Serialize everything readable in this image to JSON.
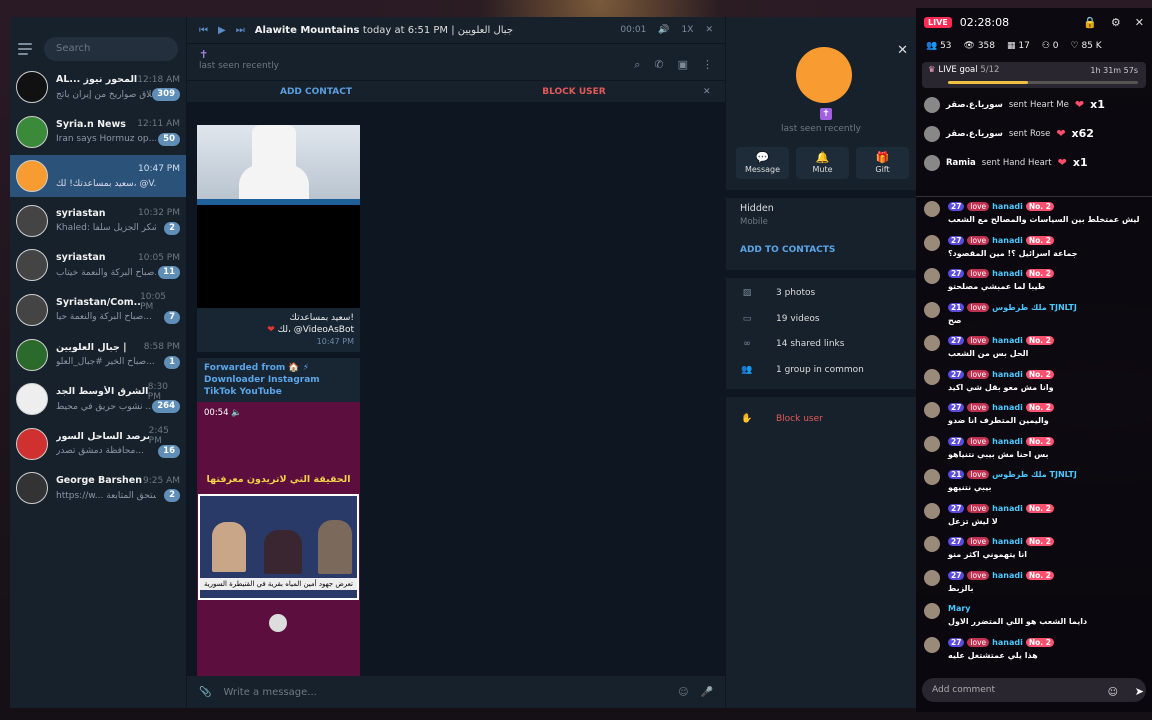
{
  "sidebar": {
    "search_placeholder": "Search",
    "chats": [
      {
        "name": "AL... المحور نيوز",
        "time": "12:18 AM",
        "preview": "إطلاق صواريخ من إيران باتج...",
        "badge": "309",
        "avatar_color": "#111111"
      },
      {
        "name": "Syria.n News",
        "time": "12:11 AM",
        "preview": "Iran says Hormuz op...",
        "badge": "50",
        "avatar_color": "#3a8a3a"
      },
      {
        "name": "",
        "time": "10:47 PM",
        "preview": "سعيد بمساعدتك! لك، @V...",
        "badge": "",
        "avatar_color": "#f89b30",
        "selected": true
      },
      {
        "name": "syriastan",
        "time": "10:32 PM",
        "preview": "Khaled: الشكر الجزيل سلفاً",
        "badge": "2",
        "avatar_color": "#444444"
      },
      {
        "name": "syriastan",
        "time": "10:05 PM",
        "preview": "صباح البركة والنعمة خيتاب...",
        "badge": "11",
        "avatar_color": "#444444"
      },
      {
        "name": "Syriastan/Com...",
        "time": "10:05 PM",
        "preview": "صباح البركة والنعمة حيا...",
        "badge": "7",
        "avatar_color": "#444444"
      },
      {
        "name": "جبال العلويين |",
        "time": "8:58 PM",
        "preview": "صباح الخير #جبال_العلو...",
        "badge": "1",
        "avatar_color": "#2a6a2a"
      },
      {
        "name": "الشرق الأوسط الجد...",
        "time": "8:30 PM",
        "preview": "نشوب حريق في محيط ...",
        "badge": "264",
        "avatar_color": "#eeeeee"
      },
      {
        "name": "مرصد الساحل السور...",
        "time": "2:45 PM",
        "preview": "محافظة دمشق تصدر...",
        "badge": "16",
        "avatar_color": "#d03030"
      },
      {
        "name": "George Barshen",
        "time": "9:25 AM",
        "preview": "https://w... تستحق المتابعة",
        "badge": "2",
        "avatar_color": "#333333"
      }
    ]
  },
  "player": {
    "title": "Alawite Mountains",
    "subtitle": "today at 6:51 PM | جبال العلويين",
    "elapsed": "00:01",
    "speed": "1X"
  },
  "chat_header": {
    "status": "last seen recently",
    "add_contact": "ADD CONTACT",
    "block_user": "BLOCK USER"
  },
  "messages": {
    "caption_line1": "سعيد بمساعدتك!",
    "caption_line2": "لك، @VideoAsBot",
    "caption_time": "10:47 PM",
    "forwarded": "Forwarded from 🏠 ⚡ Downloader Instagram TikTok YouTube",
    "video_time": "00:54",
    "video_title": "الحقيقة التي لاتريدون معرفتها",
    "video_strip": "تعرض جهود أمين المياه بقرية في القنيطرة السورية"
  },
  "compose": {
    "placeholder": "Write a message..."
  },
  "profile": {
    "status": "last seen recently",
    "btn_message": "Message",
    "btn_mute": "Mute",
    "btn_gift": "Gift",
    "phone_label": "Hidden",
    "phone_sub": "Mobile",
    "add_to_contacts": "ADD TO CONTACTS",
    "photos": "3 photos",
    "videos": "19 videos",
    "links": "14 shared links",
    "groups": "1 group in common",
    "block": "Block user"
  },
  "live": {
    "badge": "LIVE",
    "timer": "02:28:08",
    "stats": [
      "53",
      "358",
      "17",
      "0",
      "85 K"
    ],
    "goal_label": "LIVE goal",
    "goal_count": "5/12",
    "goal_time": "1h 31m 57s",
    "goal_fraction": 0.42,
    "gifts": [
      {
        "user": "سوريا.ع.صقر",
        "action": "sent Heart Me",
        "count": "x1"
      },
      {
        "user": "سوريا.ع.صقر",
        "action": "sent Rose",
        "count": "x62"
      },
      {
        "user": "Ramia",
        "action": "sent Hand Heart",
        "count": "x1"
      }
    ],
    "comments": [
      {
        "lvl": "27",
        "label": "love",
        "user": "hanadi",
        "rank": "No. 2",
        "text": "ليش عمتخلط بين السياسات والمصالح مع الشعب"
      },
      {
        "lvl": "27",
        "label": "love",
        "user": "hanadi",
        "rank": "No. 2",
        "text": "جماعة اسرائيل ؟! مين المقصود؟"
      },
      {
        "lvl": "27",
        "label": "love",
        "user": "hanadi",
        "rank": "No. 2",
        "text": "طيبا لما عمبشي مصلحتو"
      },
      {
        "lvl": "21",
        "label": "love",
        "user": "ملك طرطوس TJNLTJ",
        "rank": "",
        "text": "صح"
      },
      {
        "lvl": "27",
        "label": "love",
        "user": "hanadi",
        "rank": "No. 2",
        "text": "الحل بس من الشعب"
      },
      {
        "lvl": "27",
        "label": "love",
        "user": "hanadi",
        "rank": "No. 2",
        "text": "وانا مش معو بقل شي اكيد"
      },
      {
        "lvl": "27",
        "label": "love",
        "user": "hanadi",
        "rank": "No. 2",
        "text": "واليمين المتطرف انا ضدو"
      },
      {
        "lvl": "27",
        "label": "love",
        "user": "hanadi",
        "rank": "No. 2",
        "text": "بس احنا مش بيبي نتنياهو"
      },
      {
        "lvl": "21",
        "label": "love",
        "user": "ملك طرطوس TJNLTJ",
        "rank": "",
        "text": "بيبي نتنيهو"
      },
      {
        "lvl": "27",
        "label": "love",
        "user": "hanadi",
        "rank": "No. 2",
        "text": "لا ليش تزعل"
      },
      {
        "lvl": "27",
        "label": "love",
        "user": "hanadi",
        "rank": "No. 2",
        "text": "انا يتهموني اكثر منو"
      },
      {
        "lvl": "27",
        "label": "love",
        "user": "hanadi",
        "rank": "No. 2",
        "text": "بالزبط"
      },
      {
        "lvl": "",
        "label": "",
        "user": "Mary",
        "rank": "",
        "text": "دايما الشعب هو اللي المتضرر الاول"
      },
      {
        "lvl": "27",
        "label": "love",
        "user": "hanadi",
        "rank": "No. 2",
        "text": "هذا يلي عمتشتغل عليه"
      }
    ],
    "add_comment": "Add comment"
  }
}
